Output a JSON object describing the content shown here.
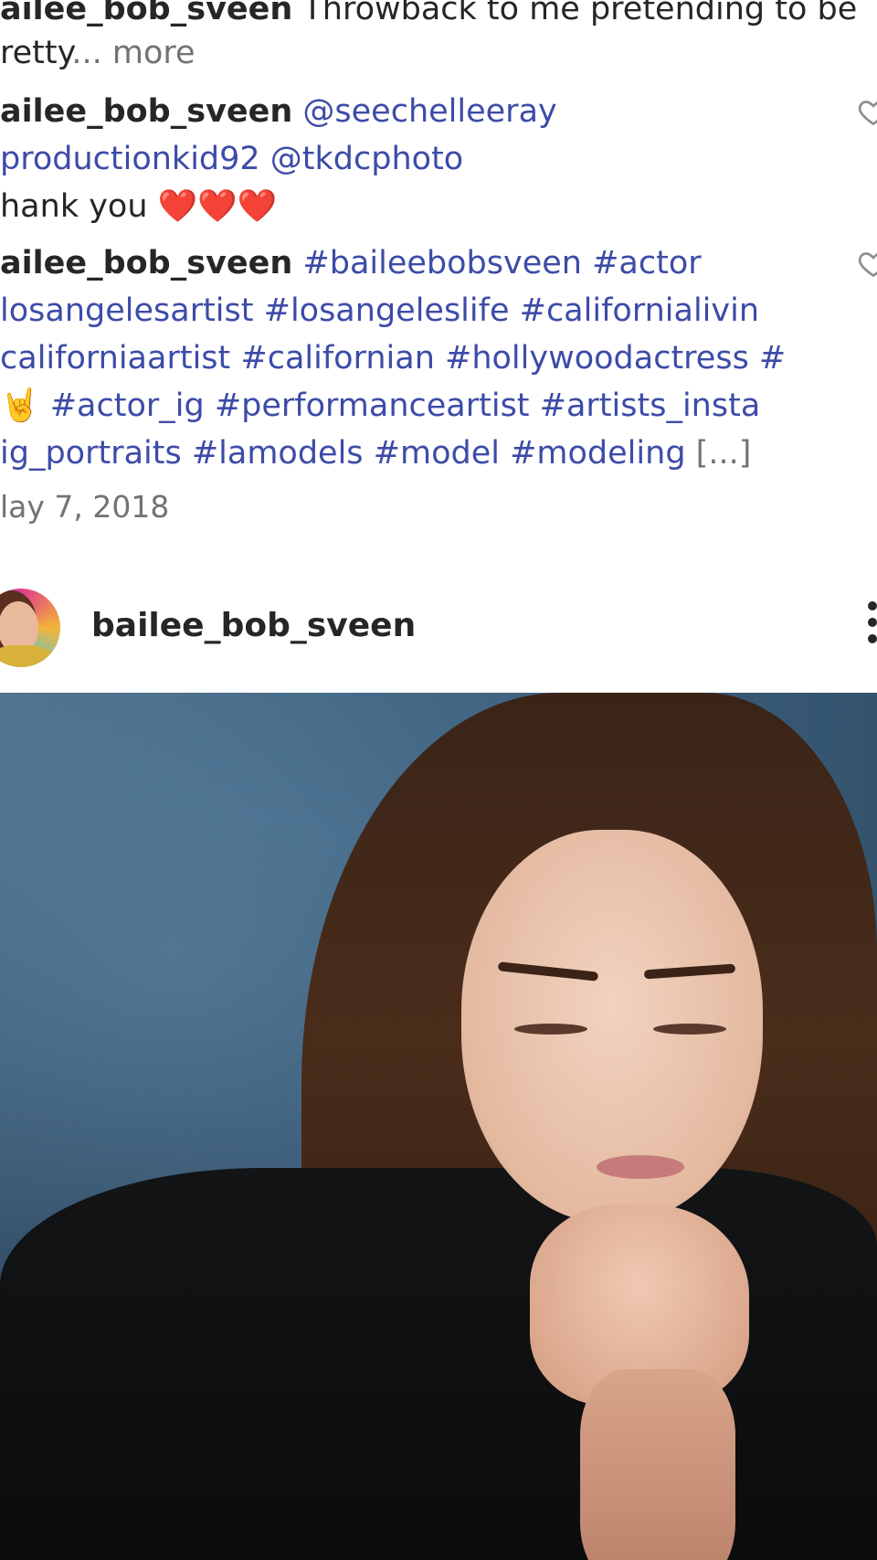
{
  "comments": [
    {
      "username": "ailee_bob_sveen",
      "text": " Throwback to me pretending to be",
      "line2": "retty",
      "ellipsis": "...",
      "more_label": " more"
    },
    {
      "username": "ailee_bob_sveen",
      "mention1": " @seechelleeray",
      "line2": "productionkid92 @tkdcphoto",
      "line3": "hank you ❤️❤️❤️"
    },
    {
      "username": "ailee_bob_sveen",
      "line1_tags": " #baileebobsveen #actor",
      "line2": "losangelesartist #losangeleslife #californialivin",
      "line3": "californiaartist #californian #hollywoodactress #",
      "line4": "🤘 #actor_ig #performanceartist #artists_insta",
      "line5": "ig_portraits #lamodels #model #modeling",
      "truncation": " [...]"
    }
  ],
  "date": "lay 7, 2018",
  "post": {
    "username": "bailee_bob_sveen"
  },
  "icons": {
    "like": "heart-outline-icon",
    "more": "more-vertical-icon"
  },
  "colors": {
    "link": "#3d4ba8",
    "text": "#262626",
    "muted": "#737373"
  }
}
